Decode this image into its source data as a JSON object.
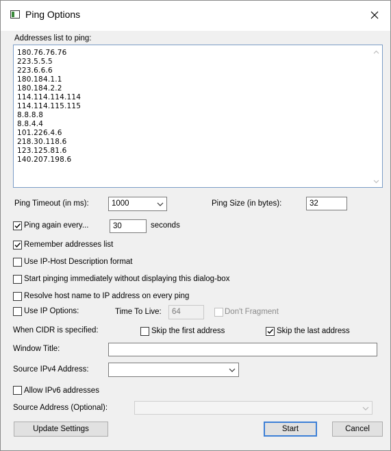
{
  "window": {
    "title": "Ping Options"
  },
  "addresses": {
    "label": "Addresses list to ping:",
    "lines": [
      "180.76.76.76",
      "223.5.5.5",
      "223.6.6.6",
      "180.184.1.1",
      "180.184.2.2",
      "114.114.114.114",
      "114.114.115.115",
      "8.8.8.8",
      "8.8.4.4",
      "101.226.4.6",
      "218.30.118.6",
      "123.125.81.6",
      "140.207.198.6"
    ]
  },
  "ping_timeout": {
    "label": "Ping Timeout (in ms):",
    "value": "1000"
  },
  "ping_size": {
    "label": "Ping Size (in bytes):",
    "value": "32"
  },
  "ping_again": {
    "label": "Ping again every...",
    "checked": true,
    "value": "30",
    "unit": "seconds"
  },
  "remember_addresses": {
    "label": "Remember addresses list",
    "checked": true
  },
  "ip_host_format": {
    "label": "Use IP-Host Description format",
    "checked": false
  },
  "start_immediately": {
    "label": "Start pinging immediately without displaying this dialog-box",
    "checked": false
  },
  "resolve_host": {
    "label": "Resolve host name to IP address on every ping",
    "checked": false
  },
  "ip_options": {
    "label": "Use IP Options:",
    "checked": false,
    "ttl_label": "Time To Live:",
    "ttl_value": "64",
    "dont_fragment": "Don't Fragment"
  },
  "cidr": {
    "label": "When CIDR is specified:",
    "skip_first": "Skip the first address",
    "skip_first_checked": false,
    "skip_last": "Skip the last address",
    "skip_last_checked": true
  },
  "window_title": {
    "label": "Window Title:",
    "value": ""
  },
  "source_ipv4": {
    "label": "Source IPv4 Address:",
    "value": ""
  },
  "allow_ipv6": {
    "label": "Allow IPv6 addresses",
    "checked": false
  },
  "source_address": {
    "label": "Source Address (Optional):",
    "value": ""
  },
  "buttons": {
    "update": "Update Settings",
    "start": "Start",
    "cancel": "Cancel"
  }
}
